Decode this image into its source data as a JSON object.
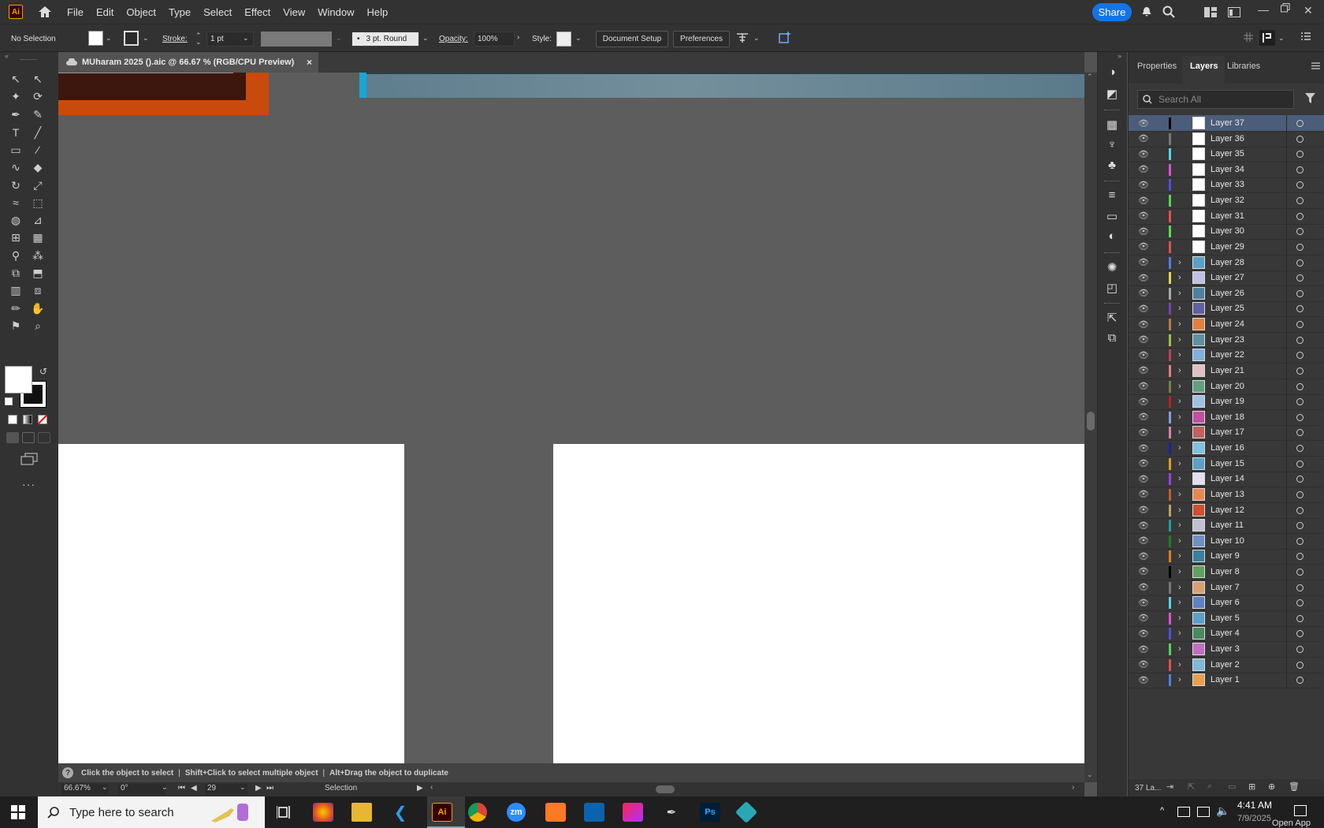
{
  "app": {
    "logo": "Ai",
    "icon_home": "home-icon"
  },
  "menu": [
    "File",
    "Edit",
    "Object",
    "Type",
    "Select",
    "Effect",
    "View",
    "Window",
    "Help"
  ],
  "share_label": "Share",
  "control_bar": {
    "selection": "No Selection",
    "stroke_label": "Stroke:",
    "stroke_value": "1 pt",
    "brush_value": "3 pt. Round",
    "opacity_label": "Opacity:",
    "opacity_value": "100%",
    "style_label": "Style:",
    "document_setup": "Document Setup",
    "preferences": "Preferences"
  },
  "document_tab": {
    "title": "MUharam 2025 ().aic @ 66.67 % (RGB/CPU Preview)",
    "close": "×"
  },
  "panel": {
    "tabs": [
      "Properties",
      "Layers",
      "Libraries"
    ],
    "active_tab": "Layers",
    "search_placeholder": "Search All",
    "layers": [
      {
        "name": "Layer 37",
        "color": "#000000",
        "expandable": false,
        "selected": true
      },
      {
        "name": "Layer 36",
        "color": "#777777",
        "expandable": false
      },
      {
        "name": "Layer 35",
        "color": "#4fd8e8",
        "expandable": false
      },
      {
        "name": "Layer 34",
        "color": "#e04fd8",
        "expandable": false
      },
      {
        "name": "Layer 33",
        "color": "#4f4fe0",
        "expandable": false
      },
      {
        "name": "Layer 32",
        "color": "#4fd84f",
        "expandable": false
      },
      {
        "name": "Layer 31",
        "color": "#e04f4f",
        "expandable": false
      },
      {
        "name": "Layer 30",
        "color": "#4fe04f",
        "expandable": false
      },
      {
        "name": "Layer 29",
        "color": "#e04f4f",
        "expandable": false
      },
      {
        "name": "Layer 28",
        "color": "#4f7fe0",
        "expandable": true
      },
      {
        "name": "Layer 27",
        "color": "#e0d84f",
        "expandable": true
      },
      {
        "name": "Layer 26",
        "color": "#aaaaaa",
        "expandable": true
      },
      {
        "name": "Layer 25",
        "color": "#7f3fb0",
        "expandable": true
      },
      {
        "name": "Layer 24",
        "color": "#b07f3f",
        "expandable": true
      },
      {
        "name": "Layer 23",
        "color": "#a0c03f",
        "expandable": true
      },
      {
        "name": "Layer 22",
        "color": "#c03f5f",
        "expandable": true
      },
      {
        "name": "Layer 21",
        "color": "#e07f7f",
        "expandable": true
      },
      {
        "name": "Layer 20",
        "color": "#7f7f3f",
        "expandable": true
      },
      {
        "name": "Layer 19",
        "color": "#c01f1f",
        "expandable": true
      },
      {
        "name": "Layer 18",
        "color": "#7f9fe0",
        "expandable": true
      },
      {
        "name": "Layer 17",
        "color": "#e07fb0",
        "expandable": true
      },
      {
        "name": "Layer 16",
        "color": "#1f1f9f",
        "expandable": true
      },
      {
        "name": "Layer 15",
        "color": "#e09f1f",
        "expandable": true
      },
      {
        "name": "Layer 14",
        "color": "#9f3fe0",
        "expandable": true
      },
      {
        "name": "Layer 13",
        "color": "#c05f1f",
        "expandable": true
      },
      {
        "name": "Layer 12",
        "color": "#c09f5f",
        "expandable": true
      },
      {
        "name": "Layer 11",
        "color": "#1fa0a0",
        "expandable": true
      },
      {
        "name": "Layer 10",
        "color": "#1f7f1f",
        "expandable": true
      },
      {
        "name": "Layer 9",
        "color": "#e07f1f",
        "expandable": true
      },
      {
        "name": "Layer 8",
        "color": "#000000",
        "expandable": true
      },
      {
        "name": "Layer 7",
        "color": "#777777",
        "expandable": true
      },
      {
        "name": "Layer 6",
        "color": "#4fd8e8",
        "expandable": true
      },
      {
        "name": "Layer 5",
        "color": "#e04fd8",
        "expandable": true
      },
      {
        "name": "Layer 4",
        "color": "#4f4fe0",
        "expandable": true
      },
      {
        "name": "Layer 3",
        "color": "#4fd84f",
        "expandable": true
      },
      {
        "name": "Layer 2",
        "color": "#e04f4f",
        "expandable": true
      },
      {
        "name": "Layer 1",
        "color": "#4f7fe0",
        "expandable": true
      }
    ],
    "layer_count": "37 La..."
  },
  "status": {
    "hint": "Click the object to select",
    "hint2": "Shift+Click to select multiple object",
    "hint3": "Alt+Drag the object to duplicate",
    "sep": "|",
    "zoom": "66.67%",
    "rotation": "0°",
    "artboard": "29",
    "tool": "Selection"
  },
  "taskbar": {
    "search_placeholder": "Type here to search",
    "time": "4:41 AM",
    "date": "7/9/2025",
    "tooltip": "Open App",
    "apps": [
      "Ai",
      "zm",
      "Ps"
    ]
  }
}
